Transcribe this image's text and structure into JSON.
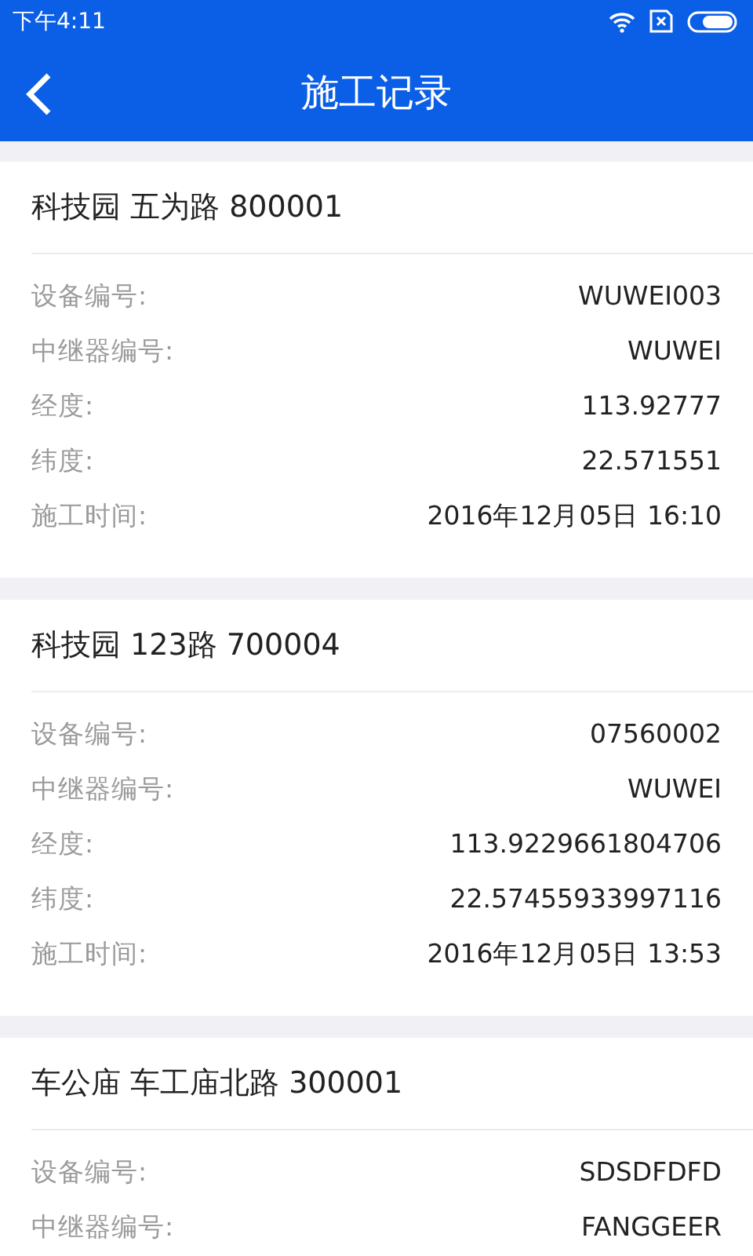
{
  "status_bar": {
    "time": "下午4:11"
  },
  "header": {
    "title": "施工记录"
  },
  "records": [
    {
      "title": "科技园 五为路 800001",
      "fields": [
        {
          "label": "设备编号:",
          "value": "WUWEI003"
        },
        {
          "label": "中继器编号:",
          "value": "WUWEI"
        },
        {
          "label": "经度:",
          "value": "113.92777"
        },
        {
          "label": "纬度:",
          "value": "22.571551"
        },
        {
          "label": "施工时间:",
          "value": "2016年12月05日 16:10"
        }
      ]
    },
    {
      "title": "科技园 123路 700004",
      "fields": [
        {
          "label": "设备编号:",
          "value": "07560002"
        },
        {
          "label": "中继器编号:",
          "value": "WUWEI"
        },
        {
          "label": "经度:",
          "value": "113.9229661804706"
        },
        {
          "label": "纬度:",
          "value": "22.57455933997116"
        },
        {
          "label": "施工时间:",
          "value": "2016年12月05日 13:53"
        }
      ]
    },
    {
      "title": "车公庙 车工庙北路 300001",
      "fields": [
        {
          "label": "设备编号:",
          "value": "SDSDFDFD"
        },
        {
          "label": "中继器编号:",
          "value": "FANGGEER"
        }
      ]
    }
  ]
}
